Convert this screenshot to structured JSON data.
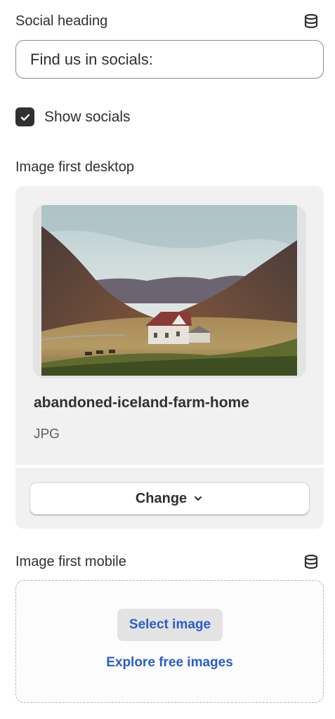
{
  "social_heading": {
    "label": "Social heading",
    "value": "Find us in socials:",
    "icon": "database-icon"
  },
  "show_socials": {
    "label": "Show socials",
    "checked": true
  },
  "image_desktop": {
    "label": "Image first desktop",
    "file_name": "abandoned-iceland-farm-home",
    "file_type": "JPG",
    "change_label": "Change"
  },
  "image_mobile": {
    "label": "Image first mobile",
    "icon": "database-icon",
    "select_label": "Select image",
    "explore_label": "Explore free images"
  },
  "colors": {
    "text": "#303030",
    "link": "#2a5ec7",
    "card_bg": "#f1f1f1"
  }
}
